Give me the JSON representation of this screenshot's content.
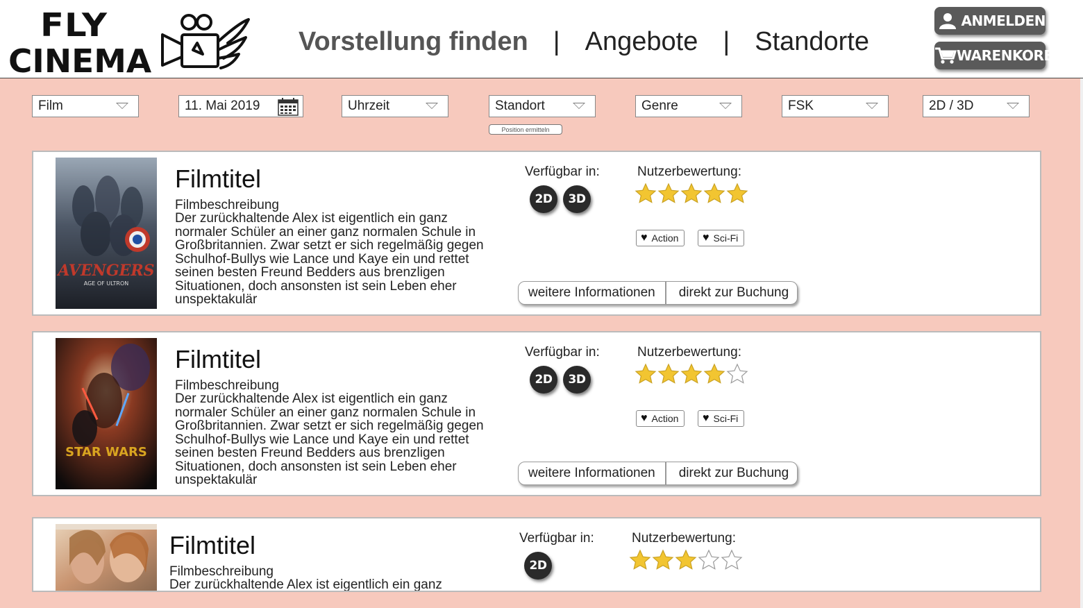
{
  "brand": {
    "line1": "FLY",
    "line2": "CINEMA",
    "icon": "projector-wing-icon"
  },
  "nav": [
    {
      "label": "Vorstellung finden",
      "active": true
    },
    {
      "label": "Angebote",
      "active": false
    },
    {
      "label": "Standorte",
      "active": false
    }
  ],
  "nav_separator": "|",
  "header_buttons": {
    "login": {
      "label": "ANMELDEN",
      "icon": "user-icon"
    },
    "cart": {
      "label": "WARENKORB",
      "icon": "cart-icon"
    }
  },
  "filters": {
    "film": "Film",
    "date": "11. Mai 2019",
    "time": "Uhrzeit",
    "location": "Standort",
    "location_sub": "Position ermitteln",
    "genre": "Genre",
    "fsk": "FSK",
    "dimension": "2D / 3D"
  },
  "labels": {
    "available": "Verfügbar in:",
    "rating": "Nutzerbewertung:",
    "more_info": "weitere Informationen",
    "booking": "direkt zur Buchung",
    "description_heading": "Filmbeschreibung"
  },
  "films": [
    {
      "title": "Filmtitel",
      "description": "Der zurückhaltende Alex ist eigentlich ein ganz normaler Schüler an einer ganz normalen Schule in Großbritannien. Zwar setzt er sich regelmäßig gegen Schulhof-Bullys wie Lance  und Kaye ein und rettet seinen besten Freund Bedders aus brenzligen Situationen, doch ansonsten ist sein Leben eher unspektakulär",
      "formats": [
        "2D",
        "3D"
      ],
      "rating": 5,
      "genres": [
        "Action",
        "Sci-Fi"
      ],
      "poster_text": "AVENGERS",
      "poster_sub": "AGE OF ULTRON"
    },
    {
      "title": "Filmtitel",
      "description": "Der zurückhaltende Alex ist eigentlich ein ganz normaler Schüler an einer ganz normalen Schule in Großbritannien. Zwar setzt er sich regelmäßig gegen Schulhof-Bullys wie Lance  und Kaye ein und rettet seinen besten Freund Bedders aus brenzligen Situationen, doch ansonsten ist sein Leben eher unspektakulär",
      "formats": [
        "2D",
        "3D"
      ],
      "rating": 4,
      "genres": [
        "Action",
        "Sci-Fi"
      ],
      "poster_text": "STAR WARS",
      "poster_sub": ""
    },
    {
      "title": "Filmtitel",
      "description": "Der zurückhaltende Alex ist eigentlich ein ganz normaler Schüler an einer ganz normalen Schule in",
      "formats": [
        "2D"
      ],
      "rating": 3,
      "genres": [],
      "poster_text": "",
      "poster_sub": ""
    }
  ],
  "colors": {
    "background": "#f7c9bd",
    "star": "#f2c531",
    "badge": "#2a2a2a",
    "header_button": "#5a5a5a"
  }
}
